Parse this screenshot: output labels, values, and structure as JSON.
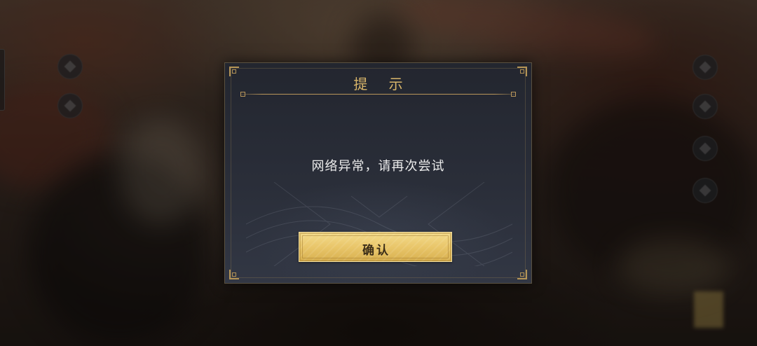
{
  "dialog": {
    "title": "提 示",
    "message": "网络异常，请再次尝试",
    "confirm_label": "确认"
  },
  "colors": {
    "title_gold": "#d9b66a",
    "button_gold": "#e9c66a",
    "dialog_bg": "#2a2e39",
    "message_text": "#ececec"
  },
  "icons": {
    "side_buttons_left": [
      "menu-round-icon",
      "menu-round-icon"
    ],
    "side_buttons_right": [
      "menu-round-icon",
      "menu-round-icon",
      "menu-round-icon",
      "menu-round-icon"
    ]
  }
}
